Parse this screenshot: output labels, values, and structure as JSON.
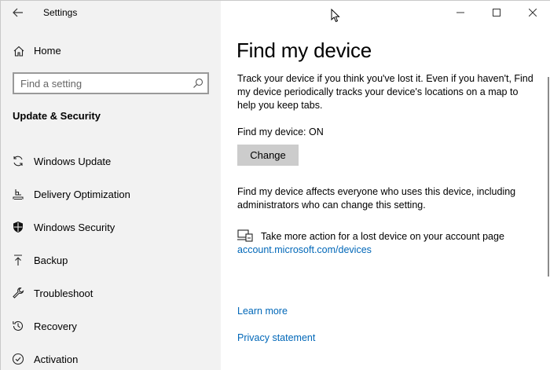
{
  "app": {
    "title": "Settings"
  },
  "sidebar": {
    "home_label": "Home",
    "search_placeholder": "Find a setting",
    "section_title": "Update & Security",
    "items": [
      {
        "label": "Windows Update",
        "icon": "sync-icon"
      },
      {
        "label": "Delivery Optimization",
        "icon": "delivery-icon"
      },
      {
        "label": "Windows Security",
        "icon": "shield-icon"
      },
      {
        "label": "Backup",
        "icon": "upload-icon"
      },
      {
        "label": "Troubleshoot",
        "icon": "wrench-icon"
      },
      {
        "label": "Recovery",
        "icon": "history-icon"
      },
      {
        "label": "Activation",
        "icon": "check-circle-icon"
      }
    ]
  },
  "main": {
    "title": "Find my device",
    "description": "Track your device if you think you've lost it. Even if you haven't, Find my device periodically tracks your device's locations on a map to help you keep tabs.",
    "status": "Find my device: ON",
    "change_label": "Change",
    "note": "Find my device affects everyone who uses this device, including administrators who can change this setting.",
    "action_text": "Take more action for a lost device on your account page",
    "account_link": "account.microsoft.com/devices",
    "learn_more": "Learn more",
    "privacy": "Privacy statement"
  },
  "colors": {
    "sidebar_bg": "#f2f2f2",
    "link": "#0067b8",
    "button_bg": "#cccccc"
  }
}
